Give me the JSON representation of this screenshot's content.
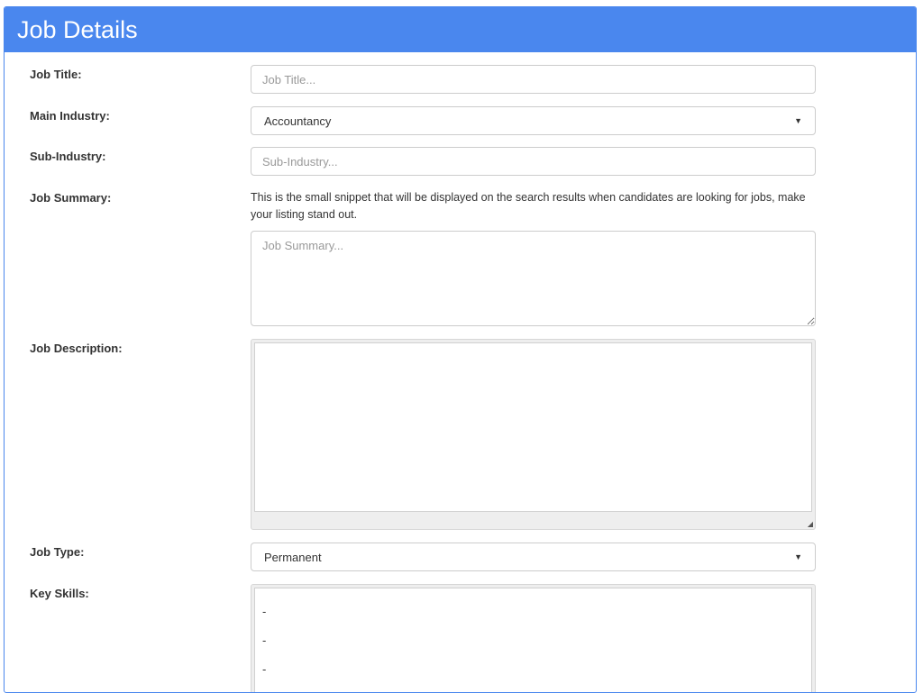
{
  "header": {
    "title": "Job Details"
  },
  "form": {
    "job_title": {
      "label": "Job Title:",
      "placeholder": "Job Title..."
    },
    "main_industry": {
      "label": "Main Industry:",
      "value": "Accountancy"
    },
    "sub_industry": {
      "label": "Sub-Industry:",
      "placeholder": "Sub-Industry..."
    },
    "job_summary": {
      "label": "Job Summary:",
      "help": "This is the small snippet that will be displayed on the search results when candidates are looking for jobs, make your listing stand out.",
      "placeholder": "Job Summary..."
    },
    "job_description": {
      "label": "Job Description:"
    },
    "job_type": {
      "label": "Job Type:",
      "value": "Permanent"
    },
    "key_skills": {
      "label": "Key Skills:",
      "items": [
        "-",
        "-",
        "-"
      ]
    }
  },
  "icons": {
    "select_caret": "caret-down-icon",
    "resize": "resize-grip-icon"
  }
}
